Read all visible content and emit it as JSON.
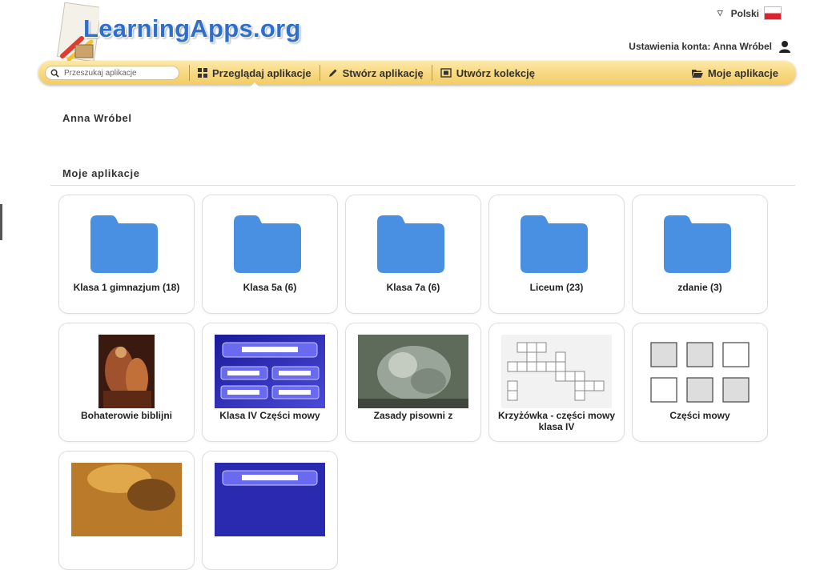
{
  "logo": {
    "text": "LearningApps.org"
  },
  "language": {
    "label": "Polski"
  },
  "account": {
    "text": "Ustawienia konta: Anna Wróbel"
  },
  "nav": {
    "search_placeholder": "Przeszukaj aplikacje",
    "browse": "Przeglądaj aplikacje",
    "create": "Stwórz aplikację",
    "collection": "Utwórz kolekcję",
    "my_apps": "Moje aplikacje"
  },
  "user_name": "Anna Wróbel",
  "section_title": "Moje aplikacje",
  "folders": [
    {
      "label": "Klasa 1 gimnazjum (18)"
    },
    {
      "label": "Klasa 5a (6)"
    },
    {
      "label": "Klasa 7a (6)"
    },
    {
      "label": "Liceum (23)"
    },
    {
      "label": "zdanie (3)"
    }
  ],
  "apps": [
    {
      "label": "Bohaterowie biblijni",
      "thumb": "painting"
    },
    {
      "label": "Klasa IV Części mowy",
      "thumb": "quiz"
    },
    {
      "label": "Zasady pisowni z",
      "thumb": "sculpture"
    },
    {
      "label": "Krzyżówka - części mowy klasa IV",
      "thumb": "crossword"
    },
    {
      "label": "Części mowy",
      "thumb": "squares"
    },
    {
      "label": "",
      "thumb": "painting-gold"
    },
    {
      "label": "",
      "thumb": "quiz"
    }
  ],
  "colors": {
    "accent": "#2f6fc9",
    "navbar": "#f7d77c",
    "folder": "#4a90e2"
  }
}
